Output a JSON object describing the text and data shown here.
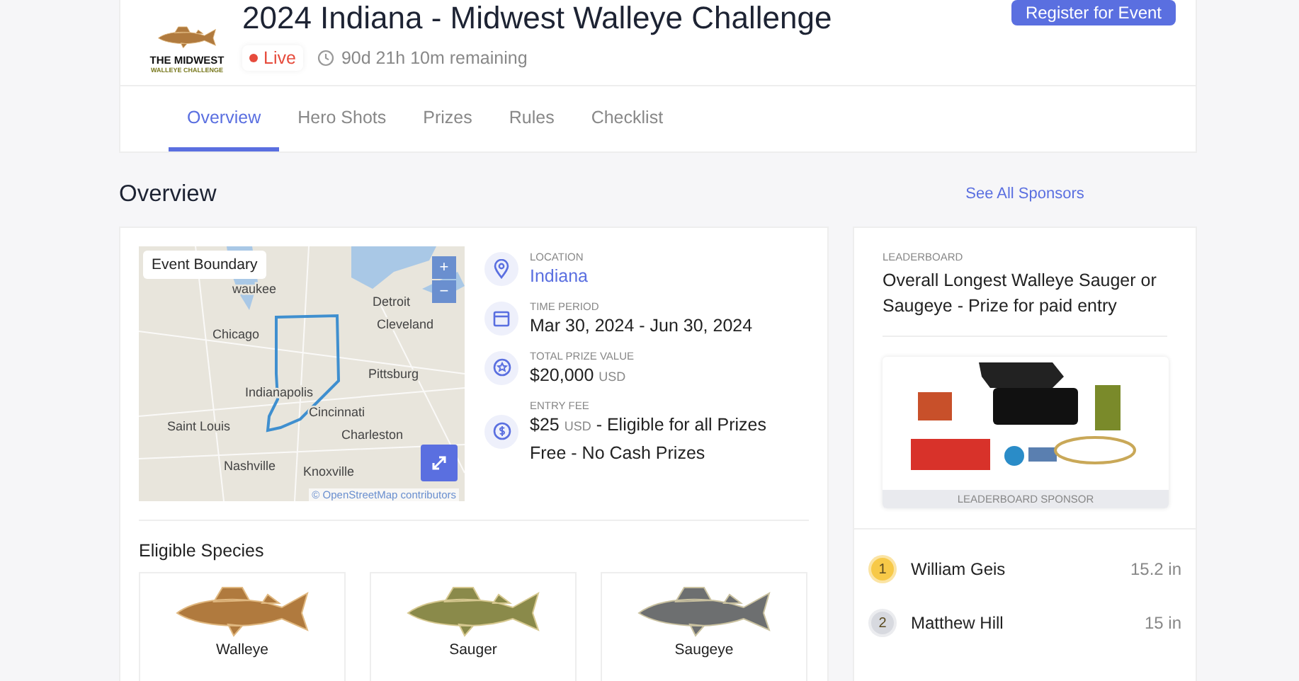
{
  "header": {
    "logo": {
      "line_1": "THE MIDWEST",
      "line_2": "WALLEYE CHALLENGE"
    },
    "title": "2024 Indiana - Midwest Walleye Challenge",
    "status": {
      "label": "Live",
      "live": true
    },
    "time_remaining": "90d 21h 10m remaining",
    "register_button": "Register for Event"
  },
  "tabs": [
    {
      "label": "Overview",
      "selected": true
    },
    {
      "label": "Hero Shots",
      "selected": false
    },
    {
      "label": "Prizes",
      "selected": false
    },
    {
      "label": "Rules",
      "selected": false
    },
    {
      "label": "Checklist",
      "selected": false
    }
  ],
  "section_title": "Overview",
  "sponsors_link": "See All Sponsors",
  "map": {
    "badge": "Event Boundary",
    "zoom_in": "+",
    "zoom_out": "−",
    "attribution": "© OpenStreetMap contributors",
    "cities": [
      "waukee",
      "Detroit",
      "Chicago",
      "Cleveland",
      "Pittsburg",
      "Indianapolis",
      "Cincinnati",
      "Saint Louis",
      "Charleston",
      "Nashville",
      "Knoxville"
    ]
  },
  "details": [
    {
      "kind": "location",
      "label": "LOCATION",
      "value": "Indiana"
    },
    {
      "kind": "period",
      "label": "TIME PERIOD",
      "value": "Mar 30, 2024 - Jun 30, 2024"
    },
    {
      "kind": "prize",
      "label": "TOTAL PRIZE VALUE",
      "value": "$20,000",
      "unit": "USD"
    },
    {
      "kind": "fee",
      "label": "ENTRY FEE",
      "value": "$25",
      "unit": "USD",
      "suffix": "- Eligible for all Prizes",
      "extra": "Free - No Cash Prizes"
    }
  ],
  "species_title": "Eligible Species",
  "species": [
    {
      "name": "Walleye"
    },
    {
      "name": "Sauger"
    },
    {
      "name": "Saugeye"
    }
  ],
  "leaderboard": {
    "label": "LEADERBOARD",
    "title": "Overall Longest Walleye Sauger or Saugeye - Prize for paid entry",
    "sponsor_label": "LEADERBOARD SPONSOR",
    "entries": [
      {
        "rank": "1",
        "color": "#f7c948",
        "name": "William Geis",
        "value": "15.2 in"
      },
      {
        "rank": "2",
        "color": "#d7d9df",
        "name": "Matthew Hill",
        "value": "15 in"
      }
    ]
  }
}
